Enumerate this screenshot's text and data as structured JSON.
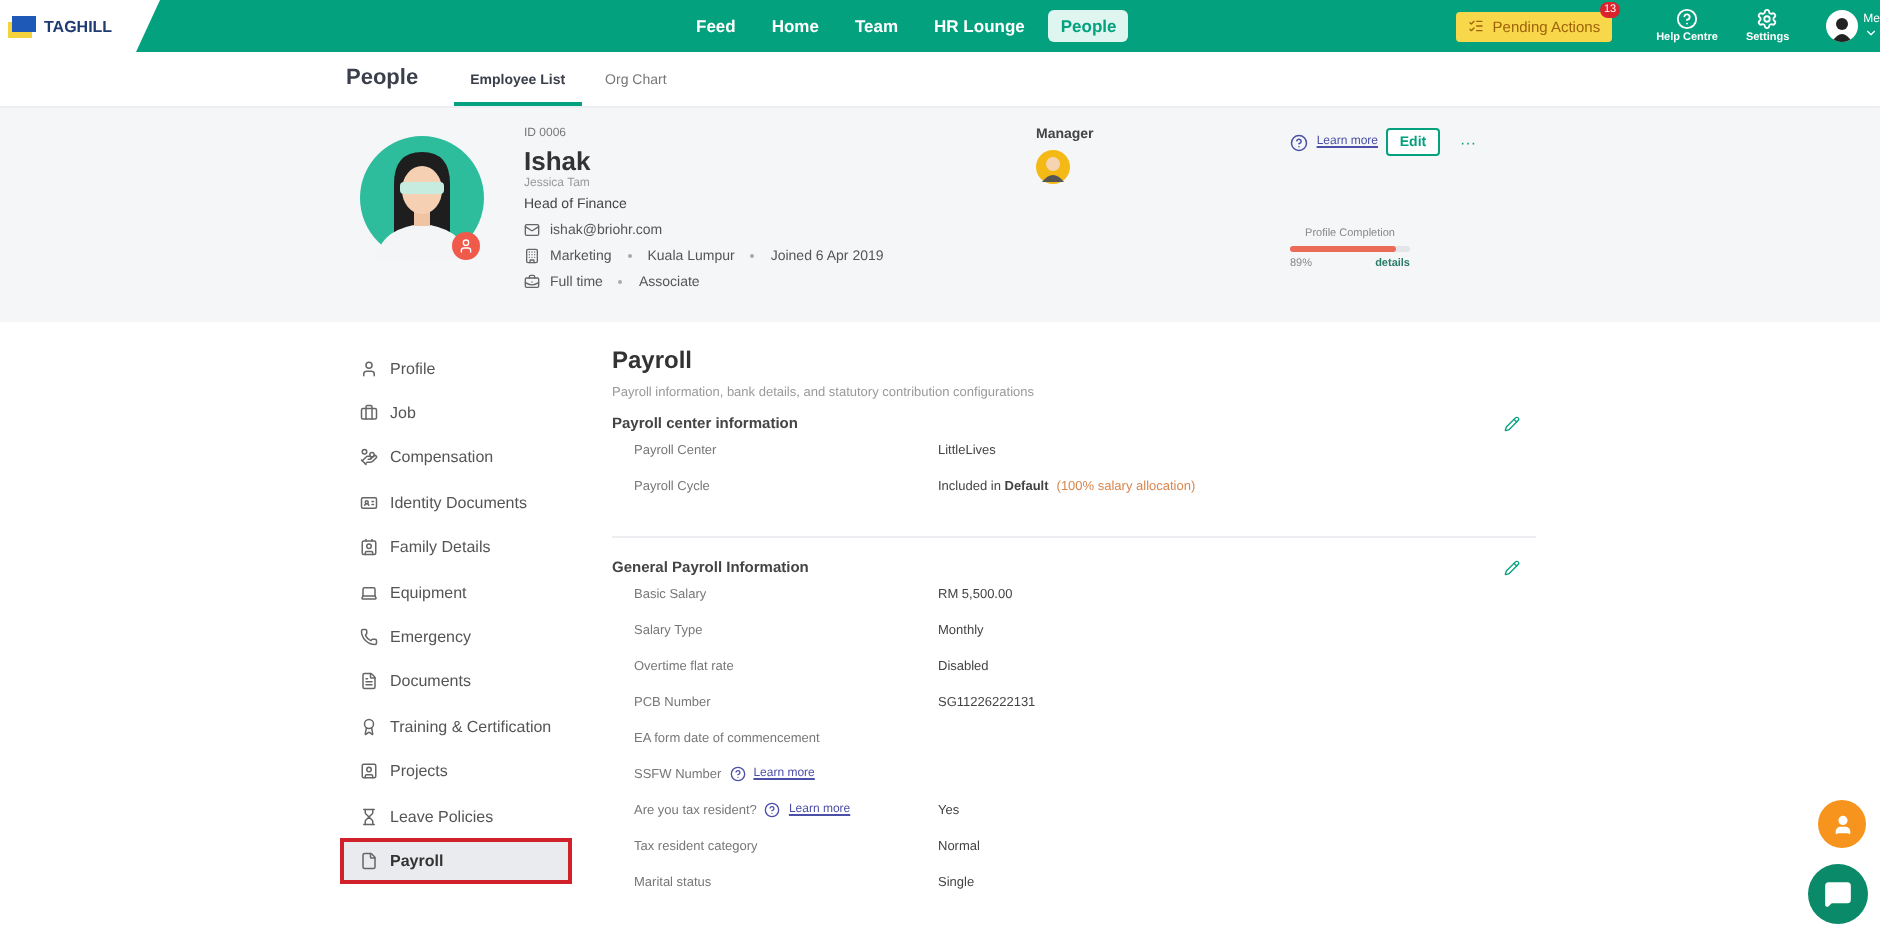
{
  "brand": "TAGHILL",
  "nav": [
    {
      "label": "Feed",
      "selected": false
    },
    {
      "label": "Home",
      "selected": false
    },
    {
      "label": "Team",
      "selected": false
    },
    {
      "label": "HR Lounge",
      "selected": false
    },
    {
      "label": "People",
      "selected": true
    }
  ],
  "pending": {
    "label": "Pending Actions",
    "count": "13"
  },
  "utilities": [
    {
      "kind": "help",
      "label": "Help Centre"
    },
    {
      "kind": "settings",
      "label": "Settings"
    }
  ],
  "user": {
    "label": "Me"
  },
  "subheader": {
    "title": "People",
    "tabs": [
      {
        "label": "Employee List",
        "selected": true
      },
      {
        "label": "Org Chart",
        "selected": false
      }
    ]
  },
  "profile": {
    "id": "ID 0006",
    "name": "Ishak",
    "alias": "Jessica Tam",
    "position": "Head of Finance",
    "email": "ishak@briohr.com",
    "details": [
      "Marketing",
      "Kuala Lumpur",
      "Joined 6 Apr 2019"
    ],
    "employment": [
      "Full time",
      "Associate"
    ],
    "manager_label": "Manager",
    "learn_more": "Learn more",
    "edit": "Edit",
    "more": "···",
    "completion": {
      "label": "Profile Completion",
      "level": 0.89,
      "percent": "89%",
      "details": "details"
    }
  },
  "sidebar": [
    {
      "kind": "profile",
      "label": "Profile",
      "selected": false
    },
    {
      "kind": "job",
      "label": "Job",
      "selected": false
    },
    {
      "kind": "compensation",
      "label": "Compensation",
      "selected": false
    },
    {
      "kind": "identity",
      "label": "Identity Documents",
      "selected": false
    },
    {
      "kind": "family",
      "label": "Family Details",
      "selected": false
    },
    {
      "kind": "equipment",
      "label": "Equipment",
      "selected": false
    },
    {
      "kind": "emergency",
      "label": "Emergency",
      "selected": false
    },
    {
      "kind": "documents",
      "label": "Documents",
      "selected": false
    },
    {
      "kind": "training",
      "label": "Training & Certification",
      "selected": false
    },
    {
      "kind": "projects",
      "label": "Projects",
      "selected": false
    },
    {
      "kind": "leave",
      "label": "Leave Policies",
      "selected": false
    },
    {
      "kind": "payroll",
      "label": "Payroll",
      "selected": true
    }
  ],
  "payroll": {
    "title": "Payroll",
    "subtitle": "Payroll information, bank details, and statutory contribution configurations",
    "sections": [
      {
        "title": "Payroll center information",
        "rows": [
          {
            "label": "Payroll Center",
            "value": "LittleLives"
          },
          {
            "label": "Payroll Cycle",
            "value": "Included in **Default**",
            "note": "(100% salary allocation)"
          }
        ]
      },
      {
        "title": "General Payroll Information",
        "rows": [
          {
            "label": "Basic Salary",
            "value": "RM 5,500.00"
          },
          {
            "label": "Salary Type",
            "value": "Monthly"
          },
          {
            "label": "Overtime flat rate",
            "value": "Disabled"
          },
          {
            "label": "PCB Number",
            "value": "SG11226222131"
          },
          {
            "label": "EA form date of commencement"
          },
          {
            "label": "SSFW Number",
            "link": "Learn more"
          },
          {
            "label": "Are you tax resident?",
            "link": "Learn more",
            "value": "Yes"
          },
          {
            "label": "Tax resident category",
            "value": "Normal"
          },
          {
            "label": "Marital status",
            "value": "Single"
          }
        ]
      }
    ]
  }
}
